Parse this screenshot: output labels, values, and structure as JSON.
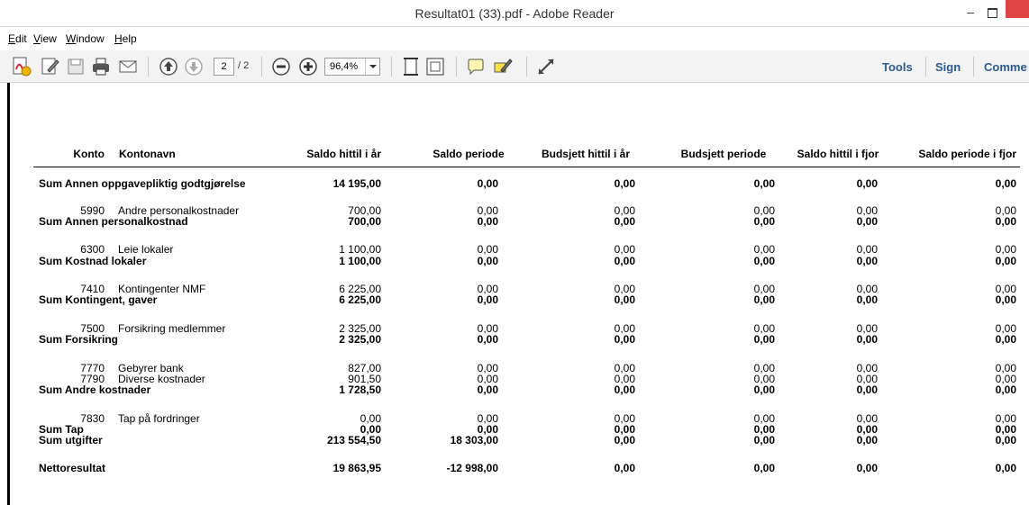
{
  "window": {
    "title": "Resultat01 (33).pdf - Adobe Reader",
    "minimize_label": "–"
  },
  "menu": {
    "items": [
      "Edit",
      "View",
      "Window",
      "Help"
    ]
  },
  "toolbar": {
    "current_page": "2",
    "total_pages": "/ 2",
    "zoom": "96,4%",
    "tools_label": "Tools",
    "sign_label": "Sign",
    "comment_label": "Comme",
    "icons": [
      "create-pdf-icon",
      "edit-icon",
      "save-icon",
      "print-icon",
      "email-icon",
      "page-up-icon",
      "page-down-icon",
      "zoom-out-icon",
      "zoom-in-icon",
      "fit-page-icon",
      "fit-width-icon",
      "comment-icon",
      "highlight-icon",
      "expand-icon"
    ]
  },
  "report": {
    "headers": {
      "konto": "Konto",
      "kontonavn": "Kontonavn",
      "saldo_hittil": "Saldo hittil i år",
      "saldo_periode": "Saldo periode",
      "budsjett_hittil": "Budsjett hittil i år",
      "budsjett_periode": "Budsjett periode",
      "saldo_hittil_fjor": "Saldo hittil i fjor",
      "saldo_periode_fjor": "Saldo periode i fjor"
    },
    "rows": [
      {
        "konto": "",
        "name": "Sum Annen oppgavepliktig godtgjørelse",
        "bold": true,
        "v": [
          "14 195,00",
          "0,00",
          "0,00",
          "0,00",
          "0,00",
          "0,00"
        ]
      },
      {
        "konto": "5990",
        "name": "Andre personalkostnader",
        "bold": false,
        "v": [
          "700,00",
          "0,00",
          "0,00",
          "0,00",
          "0,00",
          "0,00"
        ]
      },
      {
        "konto": "",
        "name": "Sum Annen personalkostnad",
        "bold": true,
        "v": [
          "700,00",
          "0,00",
          "0,00",
          "0,00",
          "0,00",
          "0,00"
        ]
      },
      {
        "konto": "6300",
        "name": "Leie lokaler",
        "bold": false,
        "v": [
          "1 100,00",
          "0,00",
          "0,00",
          "0,00",
          "0,00",
          "0,00"
        ]
      },
      {
        "konto": "",
        "name": "Sum Kostnad lokaler",
        "bold": true,
        "v": [
          "1 100,00",
          "0,00",
          "0,00",
          "0,00",
          "0,00",
          "0,00"
        ]
      },
      {
        "konto": "7410",
        "name": "Kontingenter NMF",
        "bold": false,
        "v": [
          "6 225,00",
          "0,00",
          "0,00",
          "0,00",
          "0,00",
          "0,00"
        ]
      },
      {
        "konto": "",
        "name": "Sum Kontingent, gaver",
        "bold": true,
        "v": [
          "6 225,00",
          "0,00",
          "0,00",
          "0,00",
          "0,00",
          "0,00"
        ]
      },
      {
        "konto": "7500",
        "name": "Forsikring medlemmer",
        "bold": false,
        "v": [
          "2 325,00",
          "0,00",
          "0,00",
          "0,00",
          "0,00",
          "0,00"
        ]
      },
      {
        "konto": "",
        "name": "Sum Forsikring",
        "bold": true,
        "v": [
          "2 325,00",
          "0,00",
          "0,00",
          "0,00",
          "0,00",
          "0,00"
        ]
      },
      {
        "konto": "7770",
        "name": "Gebyrer bank",
        "bold": false,
        "v": [
          "827,00",
          "0,00",
          "0,00",
          "0,00",
          "0,00",
          "0,00"
        ]
      },
      {
        "konto": "7790",
        "name": "Diverse kostnader",
        "bold": false,
        "v": [
          "901,50",
          "0,00",
          "0,00",
          "0,00",
          "0,00",
          "0,00"
        ]
      },
      {
        "konto": "",
        "name": "Sum Andre kostnader",
        "bold": true,
        "v": [
          "1 728,50",
          "0,00",
          "0,00",
          "0,00",
          "0,00",
          "0,00"
        ]
      },
      {
        "konto": "7830",
        "name": "Tap på fordringer",
        "bold": false,
        "v": [
          "0,00",
          "0,00",
          "0,00",
          "0,00",
          "0,00",
          "0,00"
        ]
      },
      {
        "konto": "",
        "name": "Sum Tap",
        "bold": true,
        "v": [
          "0,00",
          "0,00",
          "0,00",
          "0,00",
          "0,00",
          "0,00"
        ]
      },
      {
        "konto": "",
        "name": "Sum utgifter",
        "bold": true,
        "v": [
          "213 554,50",
          "18 303,00",
          "0,00",
          "0,00",
          "0,00",
          "0,00"
        ]
      },
      {
        "konto": "",
        "name": "Nettoresultat",
        "bold": true,
        "v": [
          "19 863,95",
          "-12 998,00",
          "0,00",
          "0,00",
          "0,00",
          "0,00"
        ]
      }
    ]
  }
}
